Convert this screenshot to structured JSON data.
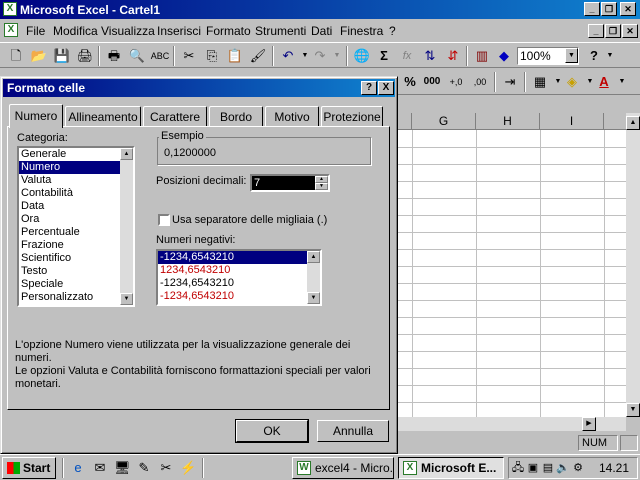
{
  "window": {
    "title": "Microsoft Excel - Cartel1",
    "app_icon": "X"
  },
  "menu": [
    "File",
    "Modifica",
    "Visualizza",
    "Inserisci",
    "Formato",
    "Strumenti",
    "Dati",
    "Finestra",
    "?"
  ],
  "toolbar": {
    "zoom": "100%",
    "sum_label": "Σ",
    "fx_label": "fx"
  },
  "format_toolbar": {
    "percent": "%",
    "thousands": "000",
    "inc_decimal": "+,0",
    "dec_decimal": ",00"
  },
  "grid": {
    "columns": [
      "G",
      "H",
      "I"
    ]
  },
  "status": {
    "num": "NUM"
  },
  "dialog": {
    "title": "Formato celle",
    "help_button": "?",
    "close_button": "X",
    "tabs": [
      "Numero",
      "Allineamento",
      "Carattere",
      "Bordo",
      "Motivo",
      "Protezione"
    ],
    "active_tab": "Numero",
    "category_label": "Categoria:",
    "categories": [
      "Generale",
      "Numero",
      "Valuta",
      "Contabilità",
      "Data",
      "Ora",
      "Percentuale",
      "Frazione",
      "Scientifico",
      "Testo",
      "Speciale",
      "Personalizzato"
    ],
    "selected_category": "Numero",
    "sample_label": "Esempio",
    "sample_value": "0,1200000",
    "decimals_label": "Posizioni decimali:",
    "decimals_value": "7",
    "thousands_label": "Usa separatore delle migliaia (.)",
    "thousands_checked": false,
    "negatives_label": "Numeri negativi:",
    "negatives": [
      {
        "text": "-1234,6543210",
        "color": "black",
        "selected": true
      },
      {
        "text": "1234,6543210",
        "color": "red",
        "selected": false
      },
      {
        "text": "-1234,6543210",
        "color": "black",
        "selected": false
      },
      {
        "text": "-1234,6543210",
        "color": "red",
        "selected": false
      }
    ],
    "description_lines": [
      "L'opzione Numero viene utilizzata per la visualizzazione generale dei numeri.",
      "Le opzioni Valuta e Contabilità forniscono formattazioni speciali per valori",
      "monetari."
    ],
    "ok_label": "OK",
    "cancel_label": "Annulla"
  },
  "taskbar": {
    "start_label": "Start",
    "tasks": [
      {
        "label": "excel4 - Micro...",
        "active": false
      },
      {
        "label": "Microsoft E...",
        "active": true
      }
    ],
    "clock": "14.21"
  },
  "colors": {
    "title_active": "#000080",
    "selection": "#000080",
    "negative_red": "#c00000",
    "face": "#c0c0c0"
  }
}
